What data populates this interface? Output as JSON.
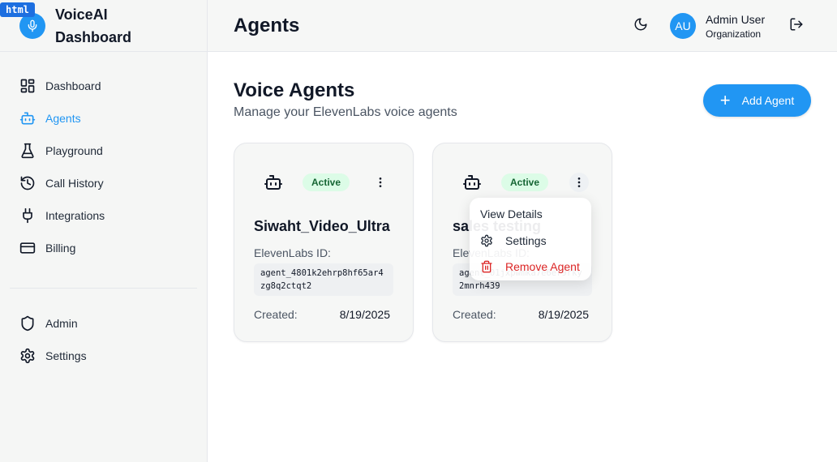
{
  "badge": "html",
  "brand": {
    "title": "VoiceAI Dashboard",
    "color": "#2196f3"
  },
  "sidebar": {
    "items": [
      {
        "label": "Dashboard",
        "icon": "grid-icon",
        "active": false
      },
      {
        "label": "Agents",
        "icon": "robot-icon",
        "active": true
      },
      {
        "label": "Playground",
        "icon": "flask-icon",
        "active": false
      },
      {
        "label": "Call History",
        "icon": "history-icon",
        "active": false
      },
      {
        "label": "Integrations",
        "icon": "plug-icon",
        "active": false
      },
      {
        "label": "Billing",
        "icon": "credit-card-icon",
        "active": false
      }
    ],
    "bottom_items": [
      {
        "label": "Admin",
        "icon": "shield-icon"
      },
      {
        "label": "Settings",
        "icon": "gear-icon"
      }
    ]
  },
  "header": {
    "title": "Agents",
    "user": {
      "initials": "AU",
      "name": "Admin User",
      "org": "Organization"
    }
  },
  "main": {
    "title": "Voice Agents",
    "subtitle": "Manage your ElevenLabs voice agents",
    "add_button": "Add Agent",
    "agents": [
      {
        "name": "Siwaht_Video_Ultra",
        "status": "Active",
        "id_label": "ElevenLabs ID:",
        "id": "agent_4801k2ehrp8hf65ar4zg8q2ctqt2",
        "created_label": "Created:",
        "created": "8/19/2025"
      },
      {
        "name": "sales testing",
        "status": "Active",
        "id_label": "ElevenLabs ID:",
        "id": "agent_01jxpwmka7e6er9rky2mnrh439",
        "created_label": "Created:",
        "created": "8/19/2025"
      }
    ]
  },
  "menu": {
    "view": "View Details",
    "settings": "Settings",
    "remove": "Remove Agent"
  },
  "colors": {
    "accent": "#2196f3",
    "active_bg": "#dcfce7",
    "active_text": "#166534",
    "danger": "#dc2626"
  }
}
